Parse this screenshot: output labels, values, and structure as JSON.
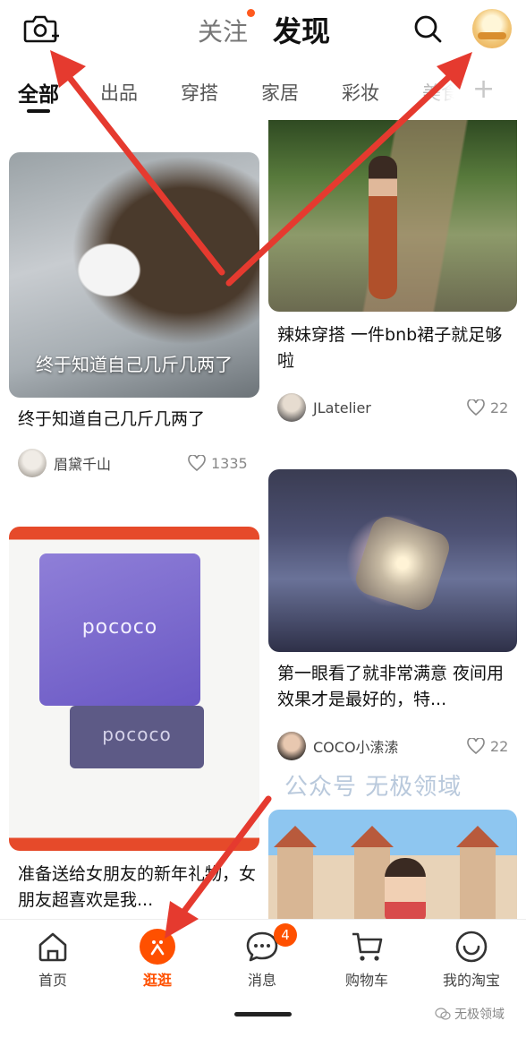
{
  "topbar": {
    "follow_tab": "关注",
    "discover_tab": "发现",
    "camera_icon": "camera-plus-icon",
    "search_icon": "search-icon"
  },
  "categories": [
    "全部",
    "出品",
    "穿搭",
    "家居",
    "彩妆",
    "美食"
  ],
  "category_add": "+",
  "cards": {
    "eagle": {
      "overlay": "终于知道自己几斤几两了",
      "title": "终于知道自己几斤几两了",
      "author": "眉黛千山",
      "likes": "1335"
    },
    "outfit": {
      "title": "辣妹穿搭 一件bnb裙子就足够啦",
      "author": "JLatelier",
      "likes": "22"
    },
    "lamp": {
      "title": "第一眼看了就非常满意 夜间用效果才是最好的，特...",
      "author": "COCO小溹溹",
      "likes": "22"
    },
    "gift": {
      "box_logo": "pococo",
      "box_logo2": "pococo",
      "title": "准备送给女朋友的新年礼物，女朋友超喜欢是我...",
      "author": ""
    }
  },
  "watermark": "公众号 无极领域",
  "nav": {
    "home": "首页",
    "stroll": "逛逛",
    "messages": "消息",
    "messages_badge": "4",
    "cart": "购物车",
    "mine": "我的淘宝"
  },
  "corner_watermark": "无极领域",
  "colors": {
    "accent": "#ff5000",
    "annotation_arrow": "#e53a2f"
  }
}
